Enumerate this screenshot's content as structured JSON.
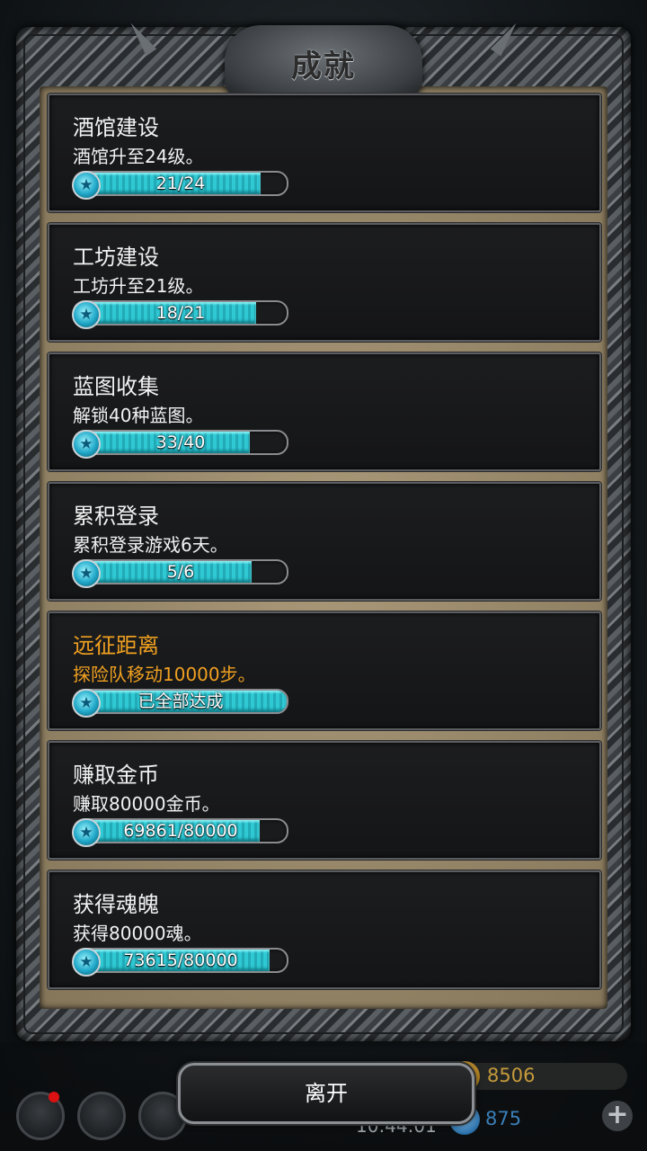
{
  "header": {
    "title": "成就"
  },
  "achievements": [
    {
      "title": "酒馆建设",
      "desc": "酒馆升至24级。",
      "progress_text": "21/24",
      "fraction": 0.875,
      "completed": false
    },
    {
      "title": "工坊建设",
      "desc": "工坊升至21级。",
      "progress_text": "18/21",
      "fraction": 0.857,
      "completed": false
    },
    {
      "title": "蓝图收集",
      "desc": "解锁40种蓝图。",
      "progress_text": "33/40",
      "fraction": 0.825,
      "completed": false
    },
    {
      "title": "累积登录",
      "desc": "累积登录游戏6天。",
      "progress_text": "5/6",
      "fraction": 0.833,
      "completed": false
    },
    {
      "title": "远征距离",
      "desc": "探险队移动10000步。",
      "progress_text": "已全部达成",
      "fraction": 1.0,
      "completed": true
    },
    {
      "title": "赚取金币",
      "desc": "赚取80000金币。",
      "progress_text": "69861/80000",
      "fraction": 0.873,
      "completed": false
    },
    {
      "title": "获得魂魄",
      "desc": "获得80000魂。",
      "progress_text": "73615/80000",
      "fraction": 0.92,
      "completed": false
    }
  ],
  "footer": {
    "leave_label": "离开",
    "gold_value": "8506",
    "soul_value": "875",
    "clock": "10:44:01"
  },
  "colors": {
    "accent": "#2fc9d4",
    "completed_text": "#f0a020"
  }
}
